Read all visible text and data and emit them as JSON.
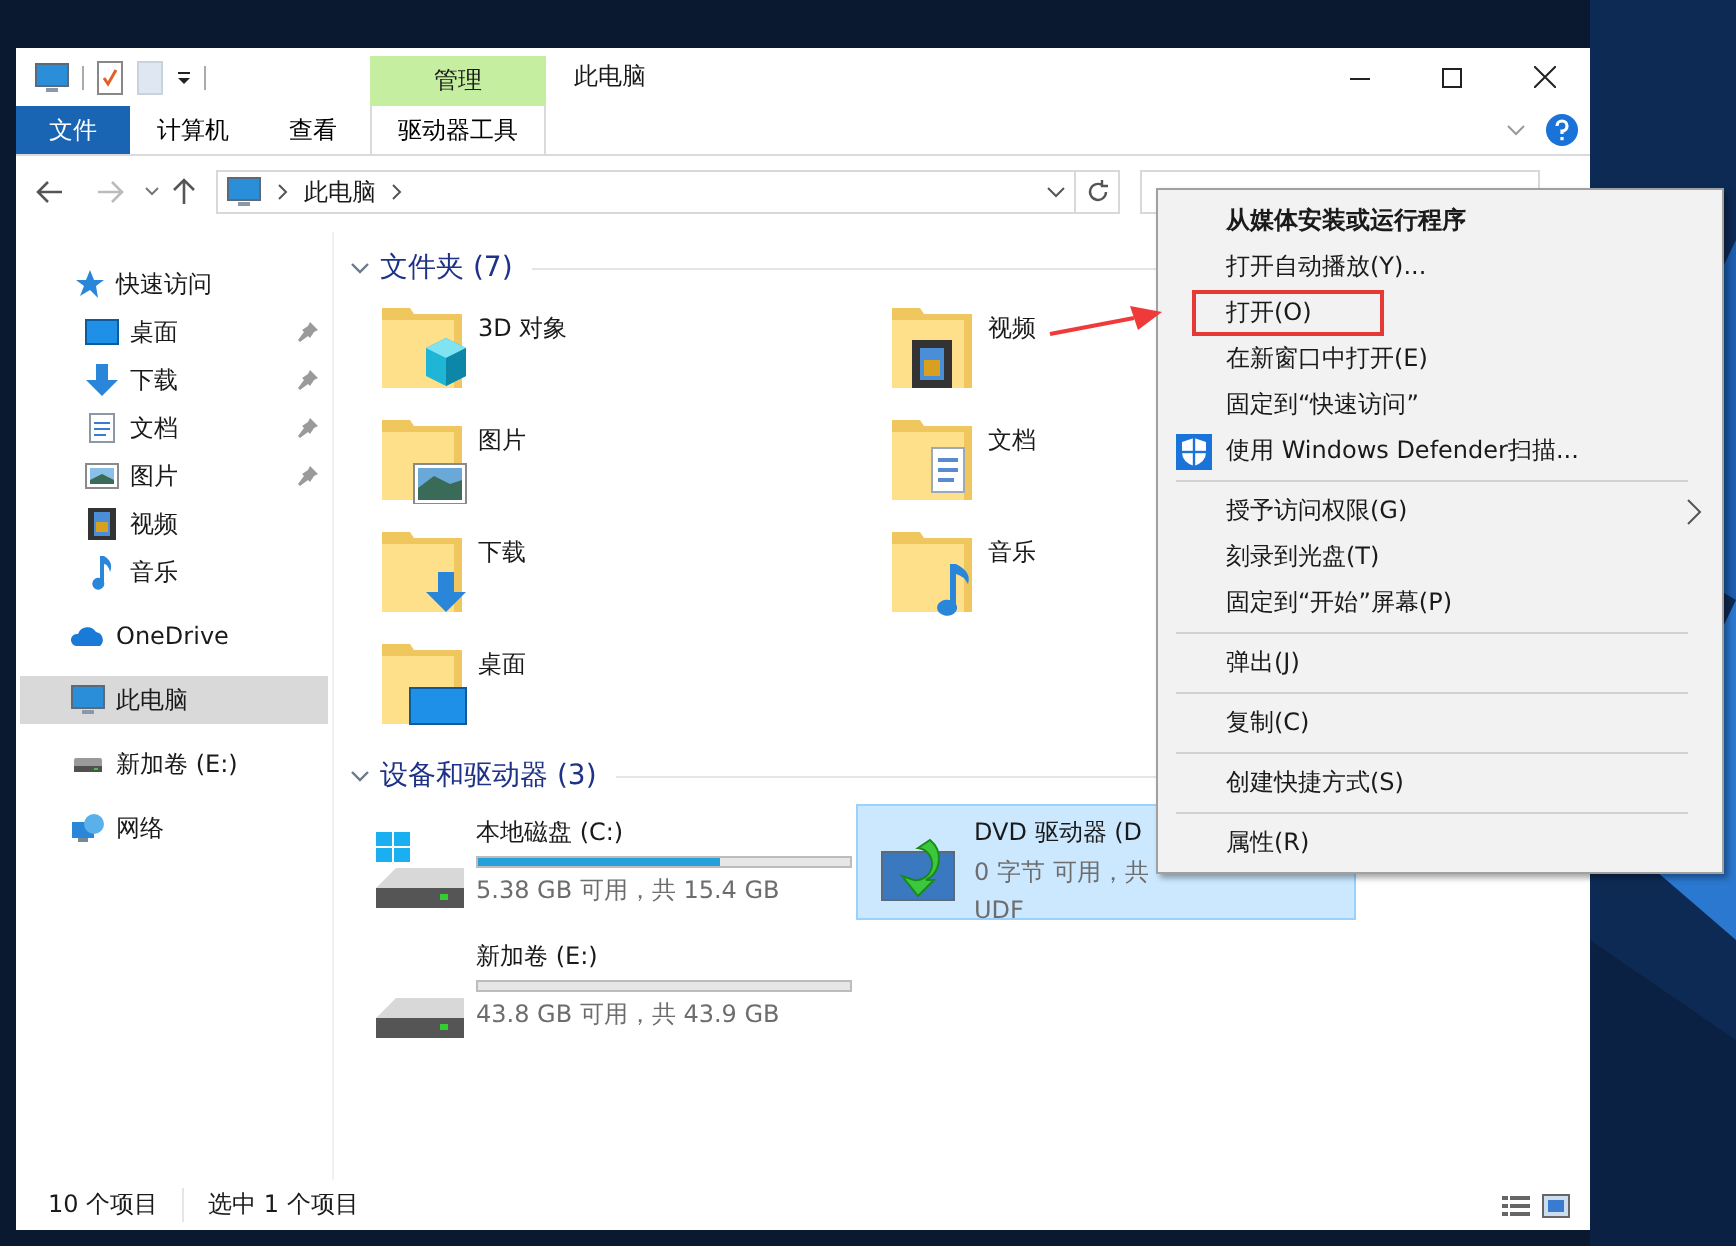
{
  "window": {
    "title": "此电脑",
    "context_group": "管理"
  },
  "ribbon_tabs": [
    {
      "label": "文件",
      "kind": "file"
    },
    {
      "label": "计算机",
      "kind": "tab"
    },
    {
      "label": "查看",
      "kind": "tab"
    },
    {
      "label": "驱动器工具",
      "kind": "context"
    }
  ],
  "address_bar": {
    "path": [
      "此电脑"
    ]
  },
  "sidebar": {
    "items": [
      {
        "label": "快速访问",
        "selected": false,
        "children": [
          {
            "label": "桌面",
            "selected": false,
            "pinned": true
          },
          {
            "label": "下载",
            "selected": false,
            "pinned": true
          },
          {
            "label": "文档",
            "selected": false,
            "pinned": true
          },
          {
            "label": "图片",
            "selected": false,
            "pinned": true
          },
          {
            "label": "视频",
            "selected": false,
            "pinned": false
          },
          {
            "label": "音乐",
            "selected": false,
            "pinned": false
          }
        ]
      },
      {
        "label": "OneDrive",
        "selected": false
      },
      {
        "label": "此电脑",
        "selected": true
      },
      {
        "label": "新加卷 (E:)",
        "selected": false
      },
      {
        "label": "网络",
        "selected": false
      }
    ]
  },
  "folders": {
    "title": "文件夹 (7)",
    "expanded": true,
    "items": [
      {
        "name": "3D 对象"
      },
      {
        "name": "视频"
      },
      {
        "name": "图片"
      },
      {
        "name": "文档"
      },
      {
        "name": "下载"
      },
      {
        "name": "音乐"
      },
      {
        "name": "桌面"
      }
    ]
  },
  "devices": {
    "title": "设备和驱动器 (3)",
    "expanded": true,
    "items": [
      {
        "name": "本地磁盘 (C:)",
        "kind": "system",
        "level": 0.65,
        "space": "5.38 GB 可用，共 15.4 GB",
        "selected": false
      },
      {
        "name": "DVD 驱动器 (D",
        "kind": "optical",
        "space": "0 字节 可用，共",
        "filesystem": "UDF",
        "selected": true
      },
      {
        "name": "新加卷 (E:)",
        "kind": "disk",
        "level": 0.0,
        "space": "43.8 GB 可用，共 43.9 GB",
        "selected": false
      }
    ]
  },
  "status_bar": {
    "item_count": "10 个项目",
    "selection": "选中 1 个项目"
  },
  "context_menu": {
    "groups": [
      [
        {
          "label": "从媒体安装或运行程序",
          "kind": "default",
          "highlighted": false
        },
        {
          "label": "打开自动播放(Y)...",
          "kind": "plain",
          "highlighted": false
        },
        {
          "label": "打开(O)",
          "kind": "plain",
          "highlighted": true
        },
        {
          "label": "在新窗口中打开(E)",
          "kind": "plain",
          "highlighted": false
        },
        {
          "label": "固定到“快速访问”",
          "kind": "plain",
          "highlighted": false
        },
        {
          "label": "使用 Windows Defender扫描...",
          "kind": "shield",
          "highlighted": false
        }
      ],
      [
        {
          "label": "授予访问权限(G)",
          "kind": "submenu",
          "highlighted": false
        },
        {
          "label": "刻录到光盘(T)",
          "kind": "plain",
          "highlighted": false
        },
        {
          "label": "固定到“开始”屏幕(P)",
          "kind": "plain",
          "highlighted": false
        }
      ],
      [
        {
          "label": "弹出(J)",
          "kind": "plain",
          "highlighted": false
        }
      ],
      [
        {
          "label": "复制(C)",
          "kind": "plain",
          "highlighted": false
        }
      ],
      [
        {
          "label": "创建快捷方式(S)",
          "kind": "plain",
          "highlighted": false
        }
      ],
      [
        {
          "label": "属性(R)",
          "kind": "plain",
          "highlighted": false
        }
      ]
    ]
  }
}
